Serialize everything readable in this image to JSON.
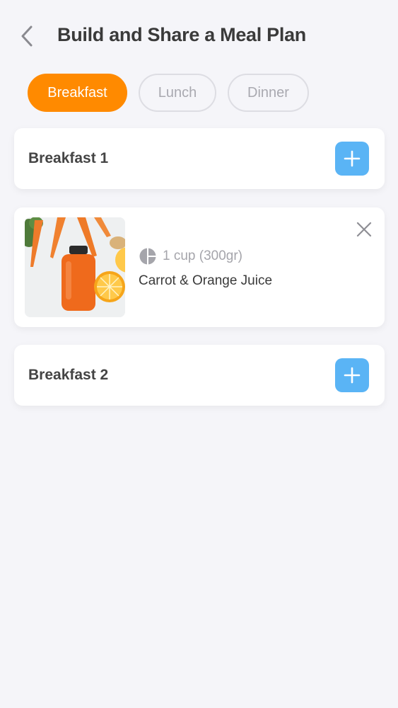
{
  "header": {
    "title": "Build and Share a Meal Plan"
  },
  "tabs": [
    {
      "label": "Breakfast",
      "active": true
    },
    {
      "label": "Lunch",
      "active": false
    },
    {
      "label": "Dinner",
      "active": false
    }
  ],
  "meals": [
    {
      "title": "Breakfast 1",
      "items": [
        {
          "portion": "1 cup (300gr)",
          "name": "Carrot & Orange Juice"
        }
      ]
    },
    {
      "title": "Breakfast 2",
      "items": []
    }
  ],
  "colors": {
    "accent": "#ff8a00",
    "add_button": "#5ab4f5",
    "background": "#f5f5f9"
  },
  "icons": {
    "back": "chevron-left-icon",
    "add": "plus-icon",
    "remove": "close-icon",
    "portion": "pie-chart-icon"
  }
}
